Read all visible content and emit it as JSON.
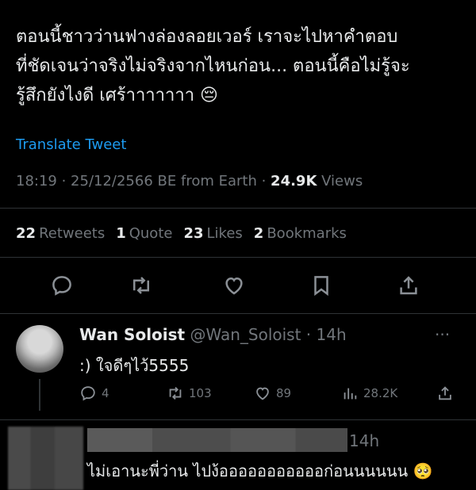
{
  "tweet": {
    "text": "ตอนนี้ชาวว่านฟางล่องลอยเวอร์ เราจะไปหาคำตอบ\nที่ชัดเจนว่าจริงไม่จริงจากไหนก่อน... ตอนนี้คือไม่รู้จะ\nรู้สึกยังไงดี เศร้าาาาาาา 😔",
    "translate_label": "Translate Tweet",
    "time": "18:19",
    "date": "25/12/2566 BE",
    "source": "from Earth",
    "views_count": "24.9K",
    "views_label": "Views"
  },
  "stats": {
    "retweets_count": "22",
    "retweets_label": "Retweets",
    "quotes_count": "1",
    "quotes_label": "Quote",
    "likes_count": "23",
    "likes_label": "Likes",
    "bookmarks_count": "2",
    "bookmarks_label": "Bookmarks"
  },
  "actions": [
    "reply-icon",
    "retweet-icon",
    "like-icon",
    "bookmark-icon",
    "share-icon"
  ],
  "reply1": {
    "name": "Wan Soloist",
    "handle": "@Wan_Soloist",
    "age": "14h",
    "text": ":) ใจดีๆไว้5555",
    "replies": "4",
    "retweets": "103",
    "likes": "89",
    "views": "28.2K"
  },
  "reply2": {
    "age": "14h",
    "text": "ไม่เอานะพี่ว่าน ไปง้อออออออออออก่อนนนนนน 🥺"
  },
  "colors": {
    "link": "#1d9bf0",
    "muted": "#71767b",
    "text": "#e7e9ea",
    "background": "#000000"
  }
}
